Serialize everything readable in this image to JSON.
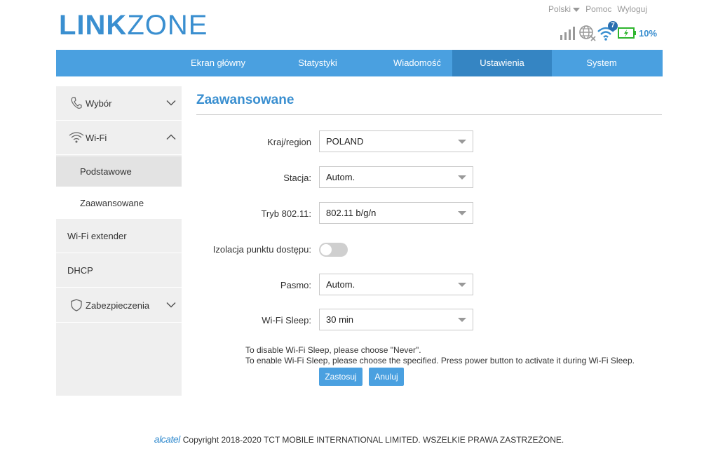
{
  "header": {
    "logo_part1": "LINK",
    "logo_part2": "ZONE",
    "language": "Polski",
    "help": "Pomoc",
    "logout": "Wyloguj",
    "wifi_clients": "7",
    "battery": "10%"
  },
  "nav": {
    "items": [
      "Ekran główny",
      "Statystyki",
      "Wiadomość",
      "Ustawienia",
      "System"
    ],
    "active_index": 3
  },
  "sidebar": {
    "wybor": "Wybór",
    "wifi": "Wi-Fi",
    "sub_basic": "Podstawowe",
    "sub_advanced": "Zaawansowane",
    "extender": "Wi-Fi extender",
    "dhcp": "DHCP",
    "security": "Zabezpieczenia"
  },
  "main": {
    "title": "Zaawansowane",
    "country_label": "Kraj/region",
    "country_value": "POLAND",
    "channel_label": "Stacja:",
    "channel_value": "Autom.",
    "mode_label": "Tryb 802.11:",
    "mode_value": "802.11 b/g/n",
    "isolation_label": "Izolacja punktu dostępu:",
    "isolation_on": false,
    "band_label": "Pasmo:",
    "band_value": "Autom.",
    "sleep_label": "Wi-Fi Sleep:",
    "sleep_value": "30 min",
    "note1": "To disable Wi-Fi Sleep, please choose \"Never\".",
    "note2": "To enable Wi-Fi Sleep, please choose the specified. Press power button to activate it during Wi-Fi Sleep.",
    "apply": "Zastosuj",
    "cancel": "Anuluj"
  },
  "footer": {
    "brand": "alcatel",
    "copyright": "Copyright 2018-2020 TCT MOBILE INTERNATIONAL LIMITED. WSZELKIE PRAWA ZASTRZEŻONE."
  },
  "colors": {
    "accent": "#4aa0e0",
    "nav_active": "#3585c3",
    "battery_green": "#2db52d"
  }
}
